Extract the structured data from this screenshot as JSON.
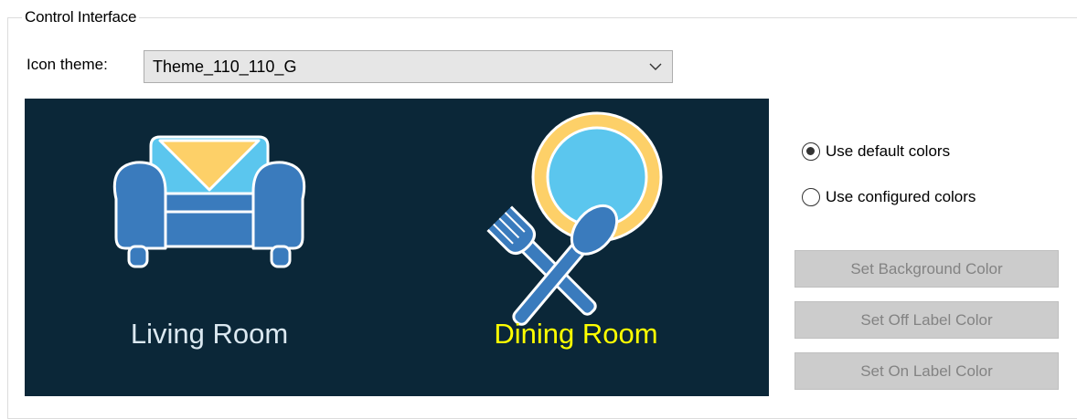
{
  "group": {
    "title": "Control Interface"
  },
  "theme": {
    "label": "Icon theme:",
    "selected": "Theme_110_110_G"
  },
  "preview": {
    "background": "#0b2738",
    "tiles": [
      {
        "label": "Living Room",
        "icon": "armchair-icon",
        "state": "off",
        "label_color": "#dbe8f0"
      },
      {
        "label": "Dining Room",
        "icon": "plate-fork-spoon-icon",
        "state": "on",
        "label_color": "#ffff00"
      }
    ]
  },
  "colors": {
    "options": [
      {
        "label": "Use default colors",
        "checked": true
      },
      {
        "label": "Use configured colors",
        "checked": false
      }
    ],
    "buttons": {
      "background": "Set Background Color",
      "off_label": "Set Off Label Color",
      "on_label": "Set On Label Color"
    }
  }
}
